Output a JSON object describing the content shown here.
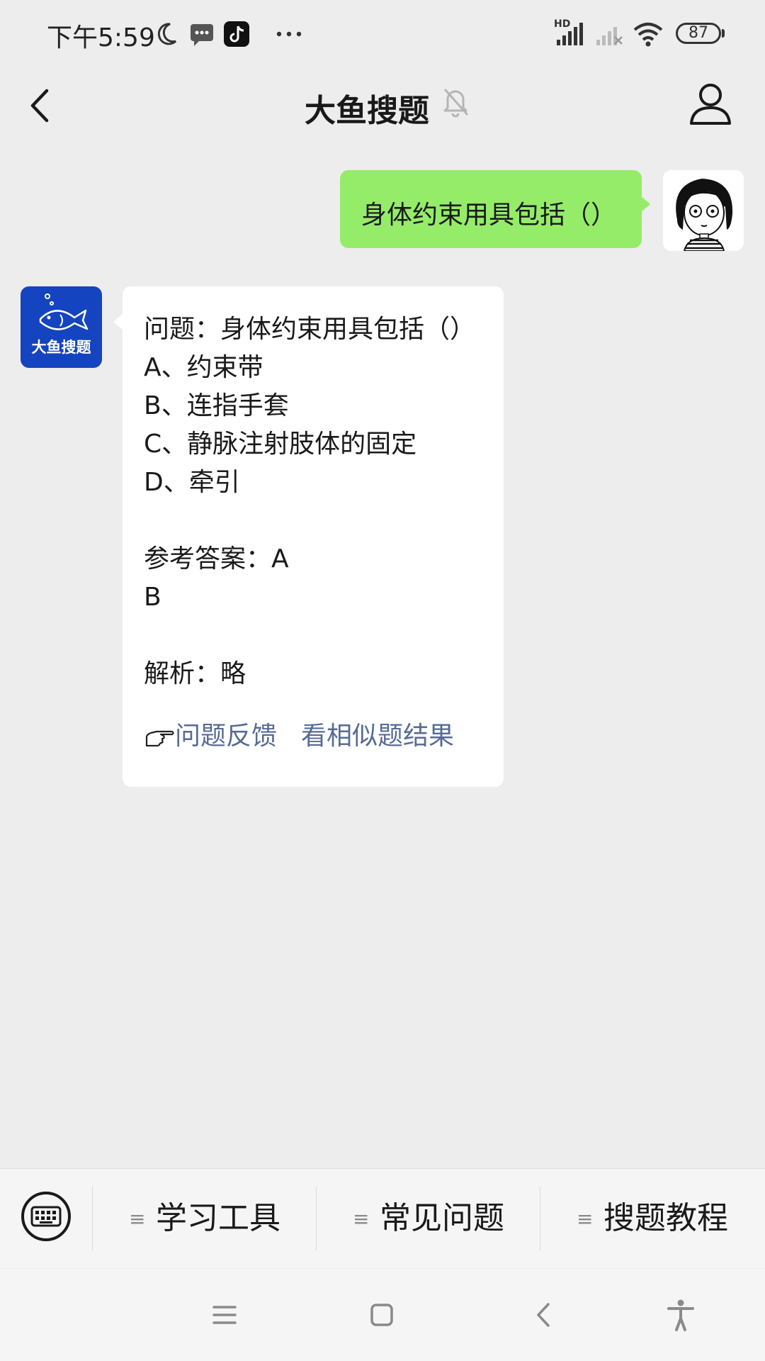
{
  "status_bar": {
    "time": "下午5:59",
    "battery": "87",
    "network_label": "HD"
  },
  "header": {
    "title": "大鱼搜题"
  },
  "chat": {
    "user_message": "身体约束用具包括（）",
    "bot_avatar_label": "大鱼搜题",
    "bot_reply": {
      "question": "问题：身体约束用具包括（）",
      "options": [
        "A、约束带",
        "B、连指手套",
        "C、静脉注射肢体的固定",
        "D、牵引"
      ],
      "answer_label": "参考答案：A",
      "answer_extra": "B",
      "analysis": "解析：略",
      "feedback_link": "问题反馈",
      "similar_link": "看相似题结果"
    }
  },
  "bottom_menu": {
    "items": [
      "学习工具",
      "常见问题",
      "搜题教程"
    ]
  },
  "colors": {
    "user_bubble": "#95ec69",
    "link": "#576b95",
    "bot_avatar_bg": "#1544c0"
  }
}
